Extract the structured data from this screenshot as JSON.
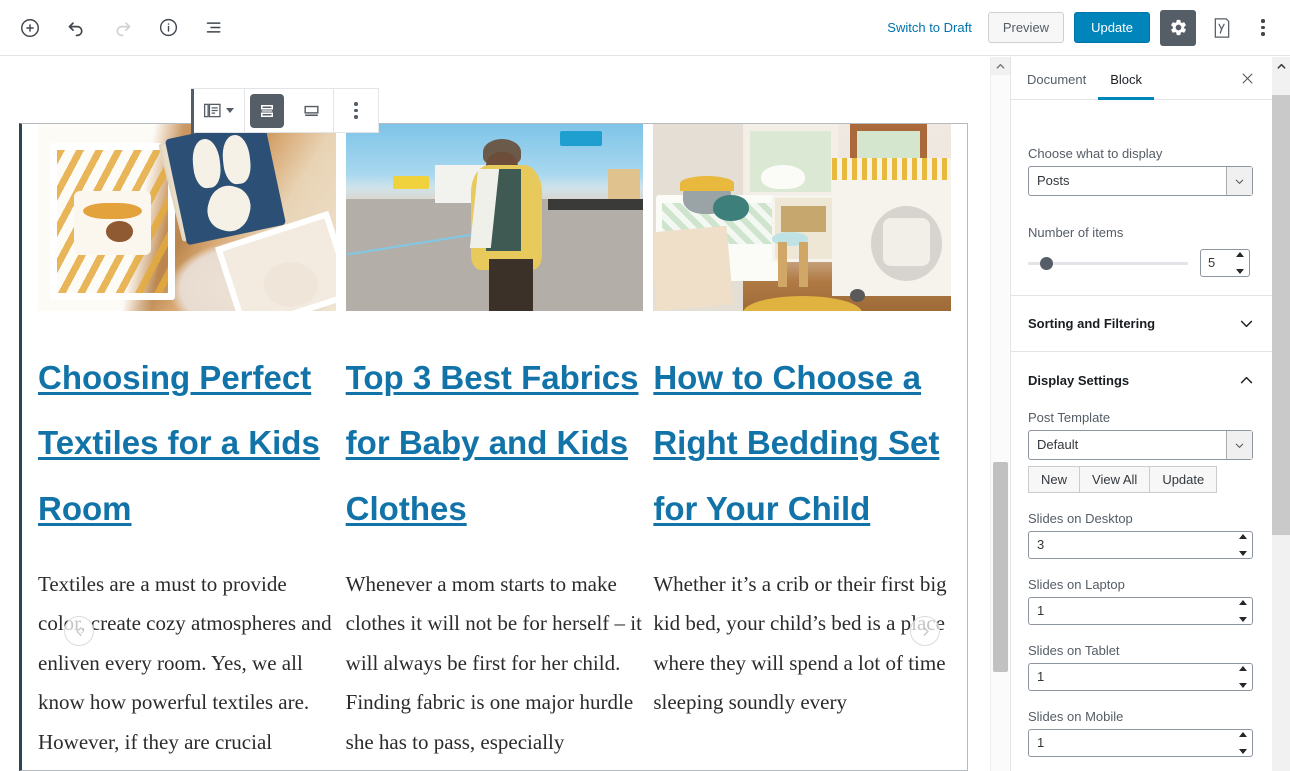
{
  "toolbar": {
    "add_block": "Add block",
    "undo": "Undo",
    "redo": "Redo",
    "info": "Content structure",
    "block_navigation": "Block navigation",
    "switch_to_draft": "Switch to Draft",
    "preview": "Preview",
    "update": "Update",
    "settings": "Settings",
    "yoast": "Yoast SEO",
    "more": "More tools & options"
  },
  "block_toolbar": {
    "block_type": "Change block type",
    "align_buttons": [
      "align-stacked",
      "align-wide"
    ],
    "more_options": "More options"
  },
  "carousel": {
    "prev": "Previous slide",
    "next": "Next slide",
    "slides": [
      {
        "image_alt": "Crib with giraffe-print bedding and navy goose quilt on wooden floor",
        "title": "Choosing Perfect Textiles for a Kids Room",
        "body": "Textiles are a must to provide color, create cozy atmospheres and enliven every room. Yes, we all know how powerful textiles are. However, if they are crucial"
      },
      {
        "image_alt": "Young child in a yellow puffer jacket and glasses standing on a street",
        "title": "Top 3 Best Fabrics for Baby and Kids Clothes",
        "body": "Whenever a mom starts to make clothes it will not be for herself – it will always be first for her child. Finding fabric is one major hurdle she has to pass, especially"
      },
      {
        "image_alt": "Bright kids bedroom with white bed, stool and storage bench by the window",
        "title": "How to Choose a Right Bedding Set for Your Child",
        "body": "Whether it’s a crib or their first big kid bed, your child’s bed is a place where they will spend a lot of time sleeping soundly every"
      }
    ]
  },
  "sidebar": {
    "tabs": [
      {
        "label": "Document",
        "active": false
      },
      {
        "label": "Block",
        "active": true
      }
    ],
    "close": "×",
    "choose_what_to_display": {
      "label": "Choose what to display",
      "value": "Posts"
    },
    "number_of_items": {
      "label": "Number of items",
      "value": "5"
    },
    "sorting_and_filtering": {
      "label": "Sorting and Filtering",
      "expanded": false
    },
    "display_settings": {
      "label": "Display Settings",
      "expanded": true,
      "post_template": {
        "label": "Post Template",
        "value": "Default",
        "buttons": [
          "New",
          "View All",
          "Update"
        ]
      },
      "slides": [
        {
          "label": "Slides on Desktop",
          "value": "3"
        },
        {
          "label": "Slides on Laptop",
          "value": "1"
        },
        {
          "label": "Slides on Tablet",
          "value": "1"
        },
        {
          "label": "Slides on Mobile",
          "value": "1"
        }
      ]
    }
  },
  "colors": {
    "accent": "#0085ba",
    "link": "#0073aa",
    "title_link": "#1273a8",
    "gear_bg": "#555d66",
    "selection_border": "#2e4453"
  }
}
